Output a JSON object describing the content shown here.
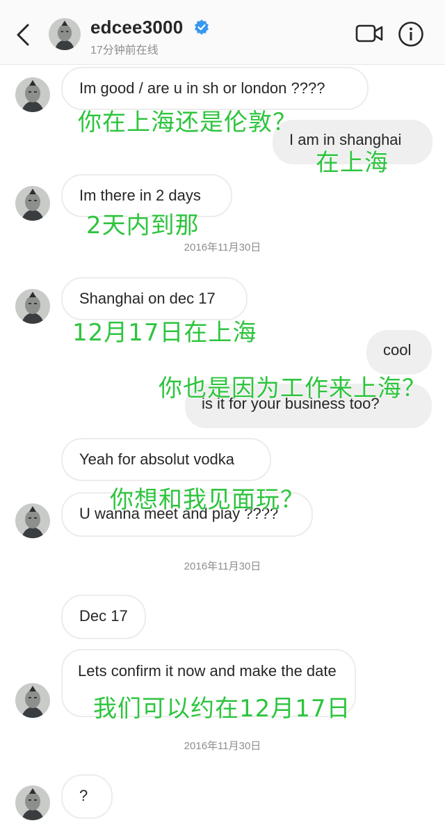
{
  "header": {
    "username": "edcee3000",
    "status": "17分钟前在线",
    "icons": {
      "back": "chevron-left-icon",
      "verified": "verified-badge-icon",
      "video": "video-call-icon",
      "info": "info-icon"
    },
    "accent": "#3897f0"
  },
  "messages": {
    "m1": "Im good / are u in sh or london ????",
    "m2": "I am in shanghai",
    "m3": "Im there in 2 days",
    "m4": "Shanghai on dec 17",
    "m5": "cool",
    "m6": "is it for your business too?",
    "m7": "Yeah for absolut vodka",
    "m8": "U wanna meet and play ????",
    "m9": "Dec 17",
    "m10": "Lets confirm it now and make the date",
    "m11": "?"
  },
  "timestamps": {
    "t1": "2016年11月30日",
    "t2": "2016年11月30日",
    "t3": "2016年11月30日"
  },
  "annotations": {
    "a1": "你在上海还是伦敦？",
    "a2": "在上海",
    "a3": "2天内到那",
    "a4": "12月17日在上海",
    "a5": "你也是因为工作来上海？",
    "a6": "你想和我见面玩？",
    "a7": "我们可以约在12月17日"
  },
  "colors": {
    "annotation": "#2ec43e",
    "incoming_bubble": "#ffffff",
    "outgoing_bubble": "#efefef",
    "timestamp": "#8e8e8e"
  }
}
